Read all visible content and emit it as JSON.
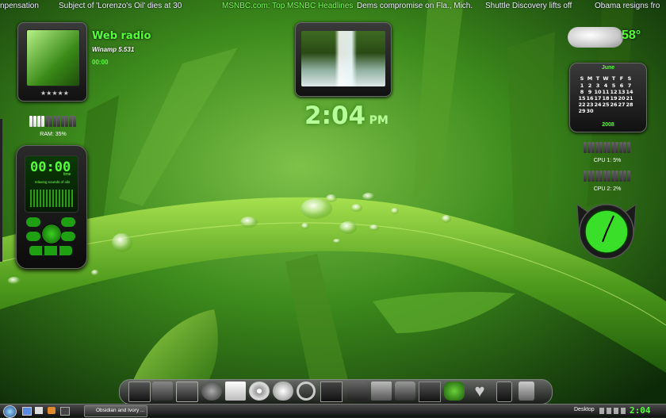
{
  "ticker": {
    "items": [
      {
        "text": "npensation",
        "hl": false
      },
      {
        "text": "Subject of 'Lorenzo's Oil' dies at 30",
        "hl": false
      },
      {
        "text": "MSNBC.com: Top MSNBC Headlines",
        "hl": true
      },
      {
        "text": "Dems compromise on Fla., Mich.",
        "hl": false
      },
      {
        "text": "Shuttle Discovery lifts off",
        "hl": false
      },
      {
        "text": "Obama resigns fro",
        "hl": false
      }
    ]
  },
  "radio": {
    "title": "Web radio",
    "player": "Winamp 5.531",
    "time": "00:00",
    "stars": "★★★★★"
  },
  "ram": {
    "label": "RAM: 35%",
    "level": 0.35
  },
  "phone": {
    "time": "00:00",
    "unit": "time",
    "caption": "relaxing sounds of oils"
  },
  "clock": {
    "time": "2:04",
    "ampm": "PM"
  },
  "weather": {
    "temp": "58°"
  },
  "calendar": {
    "month": "June",
    "days": [
      "S",
      "M",
      "T",
      "W",
      "T",
      "F",
      "S"
    ],
    "weeks": [
      [
        "1",
        "2",
        "3",
        "4",
        "5",
        "6",
        "7"
      ],
      [
        "8",
        "9",
        "10",
        "11",
        "12",
        "13",
        "14"
      ],
      [
        "15",
        "16",
        "17",
        "18",
        "19",
        "20",
        "21"
      ],
      [
        "22",
        "23",
        "24",
        "25",
        "26",
        "27",
        "28"
      ],
      [
        "29",
        "30",
        "",
        "",
        "",
        "",
        ""
      ]
    ],
    "year": "2008"
  },
  "cpu1": {
    "label": "CPU 1: 5%",
    "level": 0.05
  },
  "cpu2": {
    "label": "CPU 2: 2%",
    "level": 0.02
  },
  "dock": {
    "icons": [
      "monitor-icon",
      "network-icon",
      "computer-icon",
      "gear-icon",
      "document-icon",
      "disc-icon",
      "cloud-icon",
      "magnifier-icon",
      "display-icon",
      "media-icon",
      "folder-icon",
      "check-icon",
      "frame-icon",
      "frog-icon",
      "heart-icon",
      "phone-icon",
      "trash-icon"
    ]
  },
  "taskbar": {
    "window_title": "Obsidian and Ivory ...",
    "desktop_label": "Desktop",
    "clock": "2:04"
  },
  "colors": {
    "accent": "#56ff3a",
    "leaf": "#3a8a1a"
  }
}
